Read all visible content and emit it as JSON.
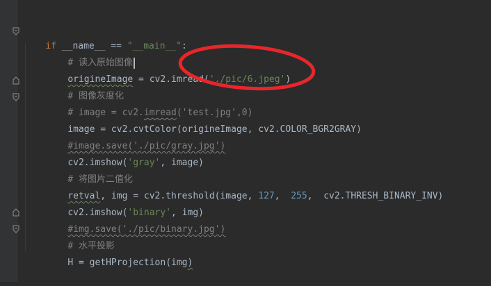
{
  "editor": {
    "lines": [
      {
        "id": "l1",
        "parts": [
          "if",
          " __name__ ",
          "==",
          " ",
          "\"__main__\"",
          ":"
        ]
      },
      {
        "id": "l2",
        "text": "# 读入原始图像"
      },
      {
        "id": "l3",
        "parts": [
          "origineImage",
          " = cv2.imread(",
          "'./pic/6.jpeg'",
          ")"
        ]
      },
      {
        "id": "l4",
        "text": "# 图像灰度化"
      },
      {
        "id": "l5",
        "parts": [
          "# image = cv2.",
          "imread",
          "('test.jpg',0)"
        ]
      },
      {
        "id": "l6",
        "text": "image = cv2.cvtColor(origineImage, cv2.COLOR_BGR2GRAY)"
      },
      {
        "id": "l7",
        "text": "#image.save('./pic/gray.jpg')"
      },
      {
        "id": "l8",
        "parts": [
          "cv2.imshow(",
          "'gray'",
          ", image)"
        ]
      },
      {
        "id": "l9",
        "text": "# 将图片二值化"
      },
      {
        "id": "l10",
        "parts": [
          "retval",
          ", img = cv2.threshold(image, ",
          "127",
          ",  ",
          "255",
          ",  cv2.THRESH_BINARY_INV)"
        ]
      },
      {
        "id": "l11",
        "parts": [
          "cv2.imshow(",
          "'binary'",
          ", img)"
        ]
      },
      {
        "id": "l12",
        "text": "#img.save('./pic/binary.jpg')"
      },
      {
        "id": "l13",
        "text": "# 水平投影"
      },
      {
        "id": "l14",
        "parts": [
          "H = getHProjection(img",
          ")"
        ]
      }
    ]
  },
  "colors": {
    "background": "#2b2b2b",
    "keyword": "#cc7832",
    "string": "#6a8759",
    "number": "#6897bb",
    "comment": "#808080",
    "annotation_circle": "#e8262b"
  },
  "icons": [
    "fold-marker-icon"
  ]
}
